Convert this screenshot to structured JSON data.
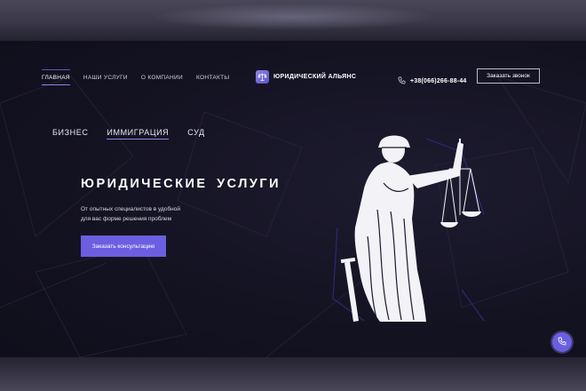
{
  "nav": {
    "items": [
      {
        "label": "ГЛАВНАЯ",
        "active": true
      },
      {
        "label": "НАШИ УСЛУГИ",
        "active": false
      },
      {
        "label": "О КОМПАНИИ",
        "active": false
      },
      {
        "label": "КОНТАКТЫ",
        "active": false
      }
    ]
  },
  "logo": {
    "text": "ЮРИДИЧЕСКИЙ АЛЬЯНС",
    "icon": "scales-icon"
  },
  "contact": {
    "phone": "+38(066)266-88-44",
    "phone_icon": "phone-icon",
    "callback_label": "Заказать звонок"
  },
  "tabs": [
    {
      "label": "БИЗНЕС",
      "active": false
    },
    {
      "label": "ИММИГРАЦИЯ",
      "active": true
    },
    {
      "label": "СУД",
      "active": false
    }
  ],
  "hero": {
    "title": "ЮРИДИЧЕСКИЕ УСЛУГИ",
    "subtitle_line1": "От опытных специалистов в удобной",
    "subtitle_line2": "для вас форме решения проблем",
    "cta_label": "Заказать консультацию",
    "image": "lady-justice-statue"
  },
  "floating_call": {
    "icon": "phone-icon"
  },
  "colors": {
    "background": "#141322",
    "accent": "#6a5fe0",
    "text": "#ffffff"
  }
}
